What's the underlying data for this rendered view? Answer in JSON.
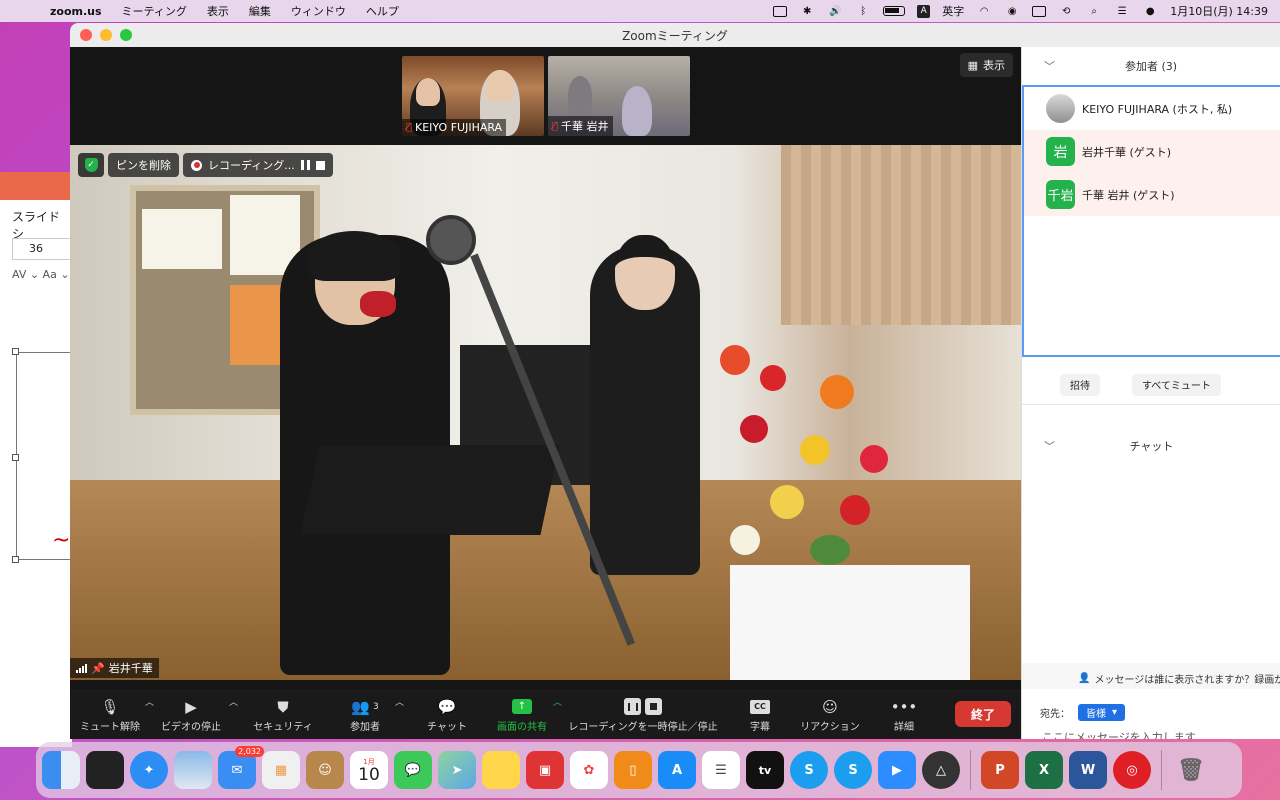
{
  "menubar": {
    "app": "zoom.us",
    "items": [
      "ミーティング",
      "表示",
      "編集",
      "ウィンドウ",
      "ヘルプ"
    ],
    "input_mode": "英字",
    "datetime": "1月10日(月)  14:39"
  },
  "background_app": {
    "tab": "スライド シ",
    "font_size": "36"
  },
  "zoom": {
    "title": "Zoomミーティング",
    "view_button": "表示",
    "thumbnails": [
      {
        "name": "KEIYO FUJIHARA"
      },
      {
        "name": "千華 岩井"
      }
    ],
    "overlay": {
      "unpin": "ピンを削除",
      "recording": "レコーディング..."
    },
    "speaker": "岩井千華",
    "toolbar": {
      "unmute": "ミュート解除",
      "stop_video": "ビデオの停止",
      "security": "セキュリティ",
      "participants": "参加者",
      "participants_count": "3",
      "chat": "チャット",
      "share": "画面の共有",
      "recording": "レコーディングを一時停止／停止",
      "captions": "字幕",
      "cc": "CC",
      "reactions": "リアクション",
      "more": "詳細",
      "end": "終了"
    }
  },
  "sidebar": {
    "participants_title": "参加者 (3)",
    "participants": [
      {
        "name": "KEIYO FUJIHARA (ホスト, 私)",
        "avatar": ""
      },
      {
        "name": "岩井千華 (ゲスト)",
        "avatar": "岩"
      },
      {
        "name": "千華 岩井 (ゲスト)",
        "avatar": "千岩"
      }
    ],
    "invite": "招待",
    "mute_all": "すべてミュート",
    "chat_title": "チャット",
    "chat_note": "メッセージは誰に表示されますか？録画が",
    "to_label": "宛先：",
    "to_value": "皆様",
    "input_placeholder": "ここにメッセージを入力します..."
  },
  "dock": {
    "mail_badge": "2,032",
    "calendar_month": "1月",
    "calendar_day": "10",
    "tv_label": "tv"
  },
  "colors": {
    "accent_green": "#23b24c",
    "end_red": "#d63832",
    "selection_blue": "#5a9cf5"
  }
}
